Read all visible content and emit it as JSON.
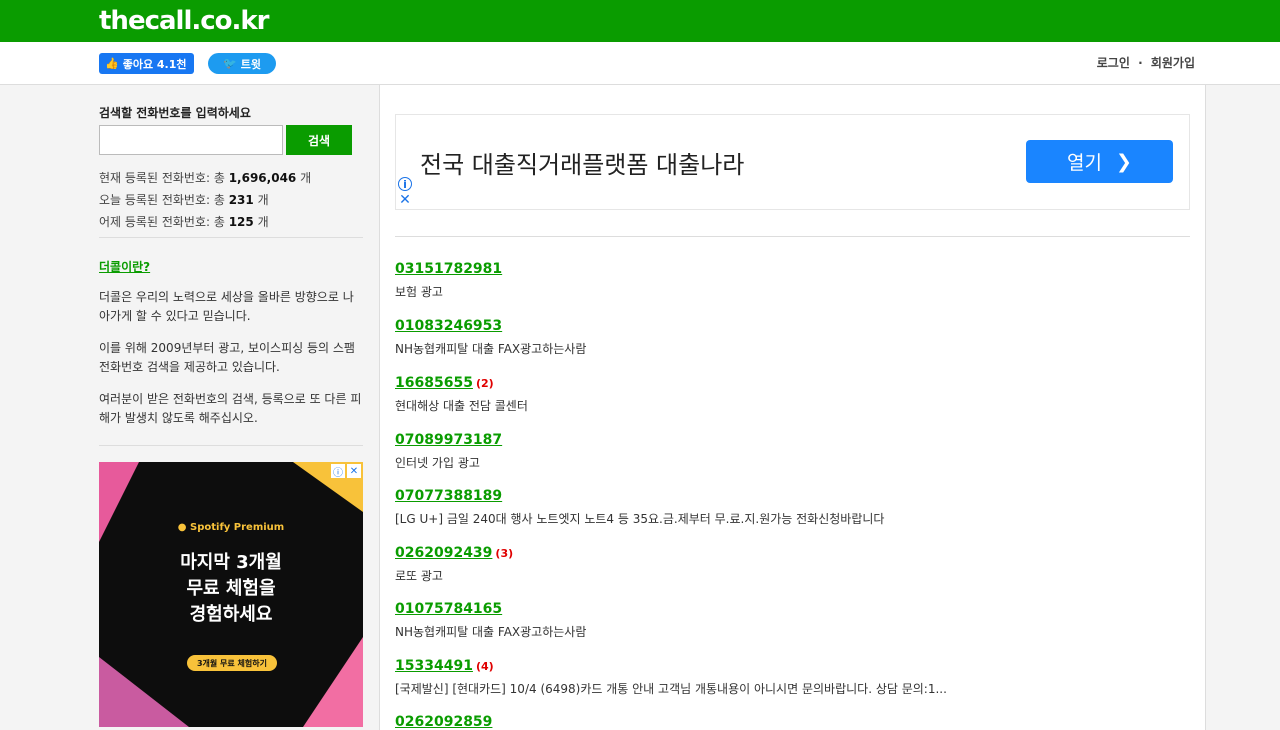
{
  "header": {
    "logo": "thecall.co.kr"
  },
  "social": {
    "like_label": "좋아요 4.1천",
    "tweet_label": "트윗"
  },
  "auth": {
    "login": "로그인",
    "separator": "·",
    "signup": "회원가입"
  },
  "sidebar": {
    "search_label": "검색할 전화번호를 입력하세요",
    "search_value": "",
    "search_button": "검색",
    "stats": [
      {
        "prefix": "현재 등록된 전화번호: 총 ",
        "value": "1,696,046",
        "suffix": " 개"
      },
      {
        "prefix": "오늘 등록된 전화번호: 총 ",
        "value": "231",
        "suffix": " 개"
      },
      {
        "prefix": "어제 등록된 전화번호: 총 ",
        "value": "125",
        "suffix": " 개"
      }
    ],
    "about_link": "더콜이란?",
    "paragraphs": [
      "더콜은 우리의 노력으로 세상을 올바른 방향으로 나아가게 할 수 있다고 믿습니다.",
      "이를 위해 2009년부터 광고, 보이스피싱 등의 스팸 전화번호 검색을 제공하고 있습니다.",
      "여러분이 받은 전화번호의 검색, 등록으로 또 다른 피해가 발생치 않도록 해주십시오."
    ],
    "ad": {
      "brand": "Spotify Premium",
      "headline": [
        "마지막 3개월",
        "무료 체험을",
        "경험하세요"
      ],
      "cta": "3개월 무료 체험하기"
    }
  },
  "top_ad": {
    "title": "전국 대출직거래플랫폼 대출나라",
    "button": "열기"
  },
  "entries": [
    {
      "number": "03151782981",
      "count": "",
      "desc": "보험 광고"
    },
    {
      "number": "01083246953",
      "count": "",
      "desc": "NH농협캐피탈 대출 FAX광고하는사람"
    },
    {
      "number": "16685655",
      "count": "(2)",
      "desc": "현대해상 대출 전담 콜센터"
    },
    {
      "number": "07089973187",
      "count": "",
      "desc": "인터넷 가입 광고"
    },
    {
      "number": "07077388189",
      "count": "",
      "desc": "[LG U+] 금일 240대 행사 노트엣지 노트4 등 35요.금.제부터 무.료.지.원가능 전화신청바랍니다"
    },
    {
      "number": "0262092439",
      "count": "(3)",
      "desc": "로또 광고"
    },
    {
      "number": "01075784165",
      "count": "",
      "desc": "NH농협캐피탈 대출 FAX광고하는사람"
    },
    {
      "number": "15334491",
      "count": "(4)",
      "desc": "[국제발신] [현대카드] 10/4 (6498)카드 개통 안내 고객님 개통내용이 아니시면 문의바랍니다. 상담 문의:1..."
    },
    {
      "number": "0262092859",
      "count": "",
      "desc": ""
    }
  ]
}
